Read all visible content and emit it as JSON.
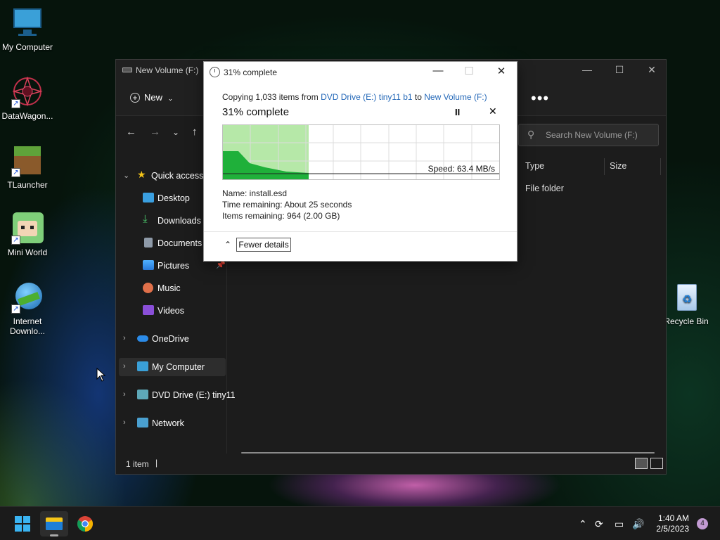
{
  "desktop": {
    "icons": [
      {
        "label": "My Computer"
      },
      {
        "label": "DataWagon..."
      },
      {
        "label": "TLauncher"
      },
      {
        "label": "Mini World"
      },
      {
        "label": "Internet Downlo..."
      },
      {
        "label": "Recycle Bin"
      }
    ]
  },
  "explorer": {
    "title": "New Volume (F:)",
    "new_label": "New",
    "search_placeholder": "Search New Volume (F:)",
    "columns": [
      "Type",
      "Size"
    ],
    "file_type": "File folder",
    "status_count": "1 item",
    "sidebar": {
      "quick_access": "Quick access",
      "items": [
        "Desktop",
        "Downloads",
        "Documents",
        "Pictures",
        "Music",
        "Videos"
      ],
      "groups": [
        "OneDrive",
        "My Computer",
        "DVD Drive (E:) tiny11",
        "Network"
      ]
    }
  },
  "copy_dialog": {
    "title": "31% complete",
    "copy_prefix": "Copying 1,033 items from",
    "source": "DVD Drive (E:) tiny11 b1",
    "to_word": "to",
    "destination": "New Volume (F:)",
    "percent_text": "31% complete",
    "progress": 0.31,
    "speed": "Speed: 63.4 MB/s",
    "name_line": "Name:  install.esd",
    "time_line": "Time remaining:  About 25 seconds",
    "items_line": "Items remaining:  964 (2.00 GB)",
    "fewer_details": "Fewer details"
  },
  "taskbar": {
    "time": "1:40 AM",
    "date": "2/5/2023",
    "notifications": "4"
  },
  "colors": {
    "accent": "#2468b8",
    "progress_fill": "#b6e8a8",
    "graph_fill": "#1fb03a"
  }
}
